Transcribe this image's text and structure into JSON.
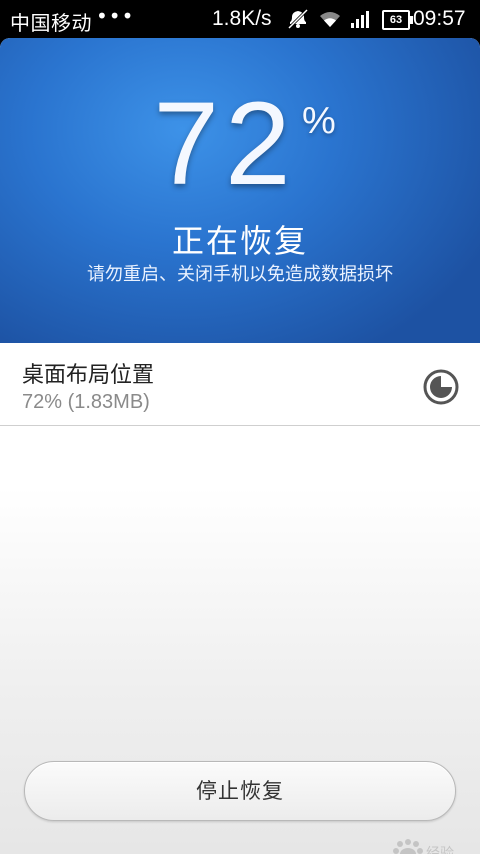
{
  "status_bar": {
    "carrier": "中国移动",
    "dots": "•••",
    "speed": "1.8K/s",
    "battery": "63",
    "time": "09:57",
    "icons": [
      "mute-icon",
      "wifi-icon",
      "signal-icon",
      "battery-icon"
    ]
  },
  "progress": {
    "value": "72",
    "unit": "%",
    "fraction": 0.72,
    "title": "正在恢复",
    "subtitle": "请勿重启、关闭手机以免造成数据损坏"
  },
  "item": {
    "title": "桌面布局位置",
    "detail": "72% (1.83MB)",
    "icon": "spinner-icon"
  },
  "actions": {
    "stop_label": "停止恢复"
  },
  "watermark": {
    "text": "jingyan.baidu.com"
  },
  "colors": {
    "hero_blue": "#2a74cf",
    "hero_dark": "#1d52a3"
  }
}
